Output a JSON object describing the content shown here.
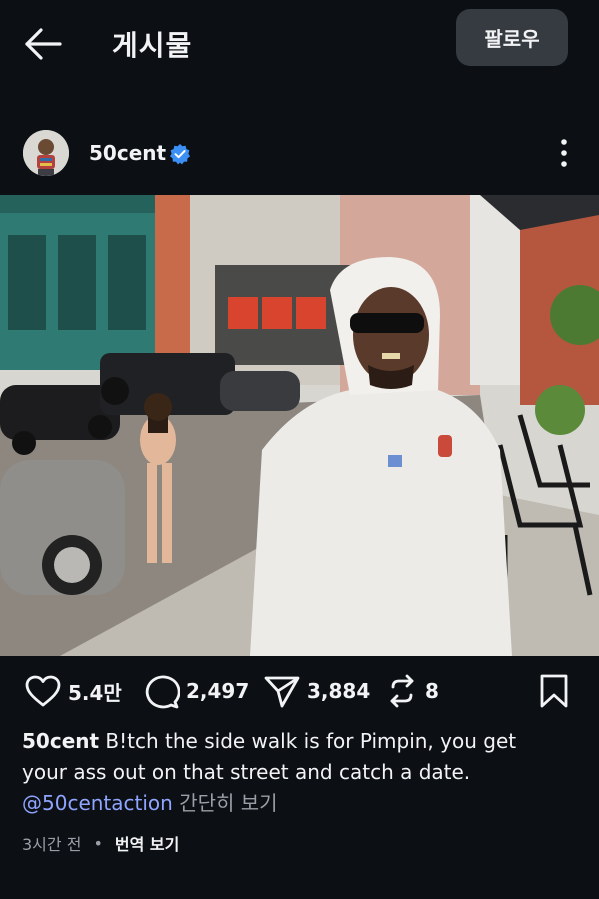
{
  "header": {
    "title": "게시물",
    "follow_label": "팔로우"
  },
  "post": {
    "author": "50cent",
    "verified": true,
    "likes": "5.4만",
    "comments": "2,497",
    "shares": "3,884",
    "reposts": "8",
    "caption_author": "50cent",
    "caption_text_1": "B!tch the side walk is for Pimpin, you get",
    "caption_text_2": "your ass out on that street and catch a date.",
    "mention": "@50centaction",
    "see_more": "간단히 보기",
    "time_ago": "3시간 전",
    "dot": "•",
    "translate": "번역 보기"
  },
  "colors": {
    "background": "#0c0f14",
    "mention": "#8fa5ff",
    "verified": "#3b8ff5",
    "follow_bg": "#363a41"
  }
}
